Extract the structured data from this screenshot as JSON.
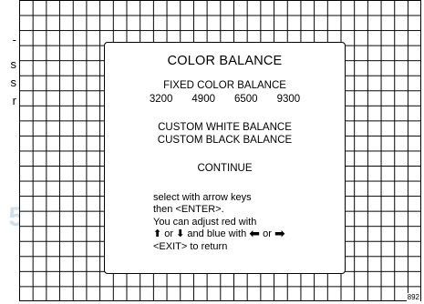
{
  "left_fragments": [
    "-",
    "s",
    "s",
    "r"
  ],
  "ghost_digit": "5",
  "menu": {
    "title": "COLOR BALANCE",
    "fixed_label": "FIXED COLOR BALANCE",
    "temperatures": [
      "3200",
      "4900",
      "6500",
      "9300"
    ],
    "custom_white": "CUSTOM WHITE BALANCE",
    "custom_black": "CUSTOM BLACK BALANCE",
    "continue": "CONTINUE"
  },
  "instructions": {
    "line1": "select with arrow keys",
    "line2": "then <ENTER>.",
    "line3": "You can adjust red with",
    "or1": "or",
    "and_blue": "and blue with",
    "or2": "or",
    "line5": "<EXIT> to return",
    "arrow_up": "🡅",
    "arrow_down": "🡇",
    "arrow_left": "⬅",
    "arrow_right": "➡"
  },
  "figure_id": "892"
}
